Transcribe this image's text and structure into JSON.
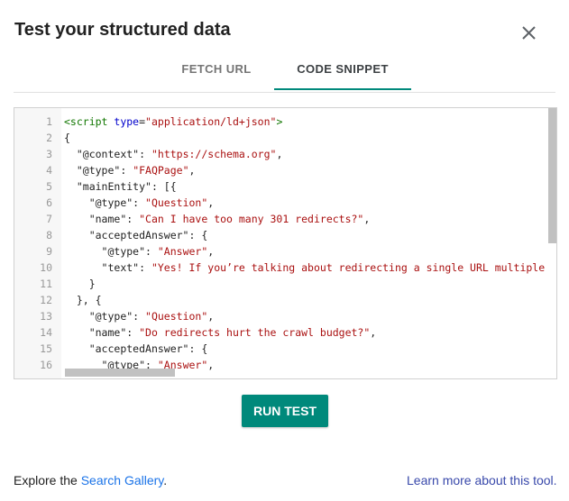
{
  "dialog": {
    "title": "Test your structured data"
  },
  "tabs": [
    {
      "label": "FETCH URL",
      "active": false
    },
    {
      "label": "CODE SNIPPET",
      "active": true
    }
  ],
  "icons": {
    "close": "close-icon"
  },
  "editor": {
    "line_numbers": [
      "1",
      "2",
      "3",
      "4",
      "5",
      "6",
      "7",
      "8",
      "9",
      "10",
      "11",
      "12",
      "13",
      "14",
      "15",
      "16"
    ],
    "lines": [
      "<script type=\"application/ld+json\">",
      "{",
      "  \"@context\": \"https://schema.org\",",
      "  \"@type\": \"FAQPage\",",
      "  \"mainEntity\": [{",
      "    \"@type\": \"Question\",",
      "    \"name\": \"Can I have too many 301 redirects?\",",
      "    \"acceptedAnswer\": {",
      "      \"@type\": \"Answer\",",
      "      \"text\": \"Yes! If you’re talking about redirecting a single URL multiple",
      "    }",
      "  }, {",
      "    \"@type\": \"Question\",",
      "    \"name\": \"Do redirects hurt the crawl budget?\",",
      "    \"acceptedAnswer\": {",
      "      \"@type\": \"Answer\","
    ]
  },
  "actions": {
    "run_test": "RUN TEST"
  },
  "footer": {
    "explore_prefix": "Explore the ",
    "search_gallery": "Search Gallery",
    "explore_suffix": ".",
    "learn_more": "Learn more about this tool."
  },
  "colors": {
    "accent": "#00897b",
    "link": "#1a73e8"
  }
}
